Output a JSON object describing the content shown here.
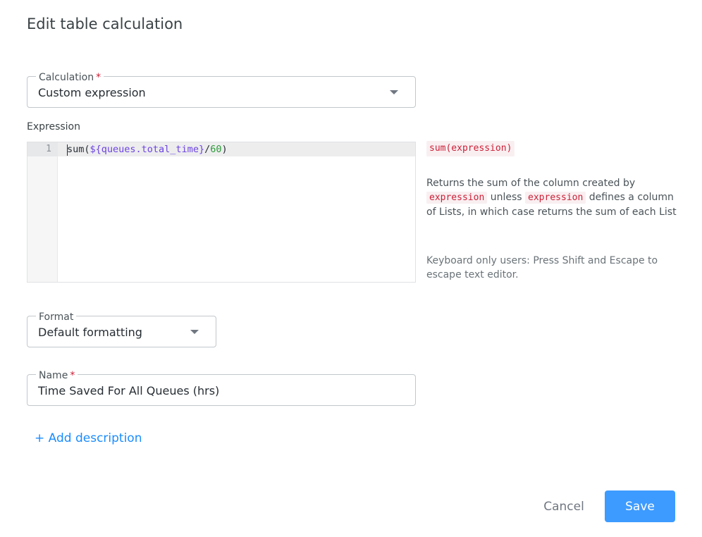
{
  "dialog": {
    "title": "Edit table calculation"
  },
  "calculation": {
    "label": "Calculation",
    "required_mark": "*",
    "value": "Custom expression"
  },
  "expression": {
    "label": "Expression",
    "line_number": "1",
    "code": {
      "fn_open": "sum(",
      "var": "${queues.total_time}",
      "op": "/",
      "num": "60",
      "close": ")"
    }
  },
  "help": {
    "signature": "sum(expression)",
    "desc_part1": "Returns the sum of the column created by",
    "desc_code1": "expression",
    "desc_part2": " unless ",
    "desc_code2": "expression",
    "desc_part3": " defines a column of Lists, in which case returns the sum of each List",
    "keyboard_note": "Keyboard only users: Press Shift and Escape to escape text editor."
  },
  "format": {
    "label": "Format",
    "value": "Default formatting"
  },
  "name": {
    "label": "Name",
    "required_mark": "*",
    "value": "Time Saved For All Queues (hrs)"
  },
  "add_description": "+ Add description",
  "buttons": {
    "cancel": "Cancel",
    "save": "Save"
  },
  "colors": {
    "accent": "#3d9bff",
    "link": "#1a8cff",
    "required": "#cc1f36",
    "code_variable": "#6c43e0",
    "code_number": "#2b9b38"
  },
  "icons": {
    "calculation_dropdown": "chevron-down-icon",
    "format_dropdown": "chevron-down-icon"
  }
}
